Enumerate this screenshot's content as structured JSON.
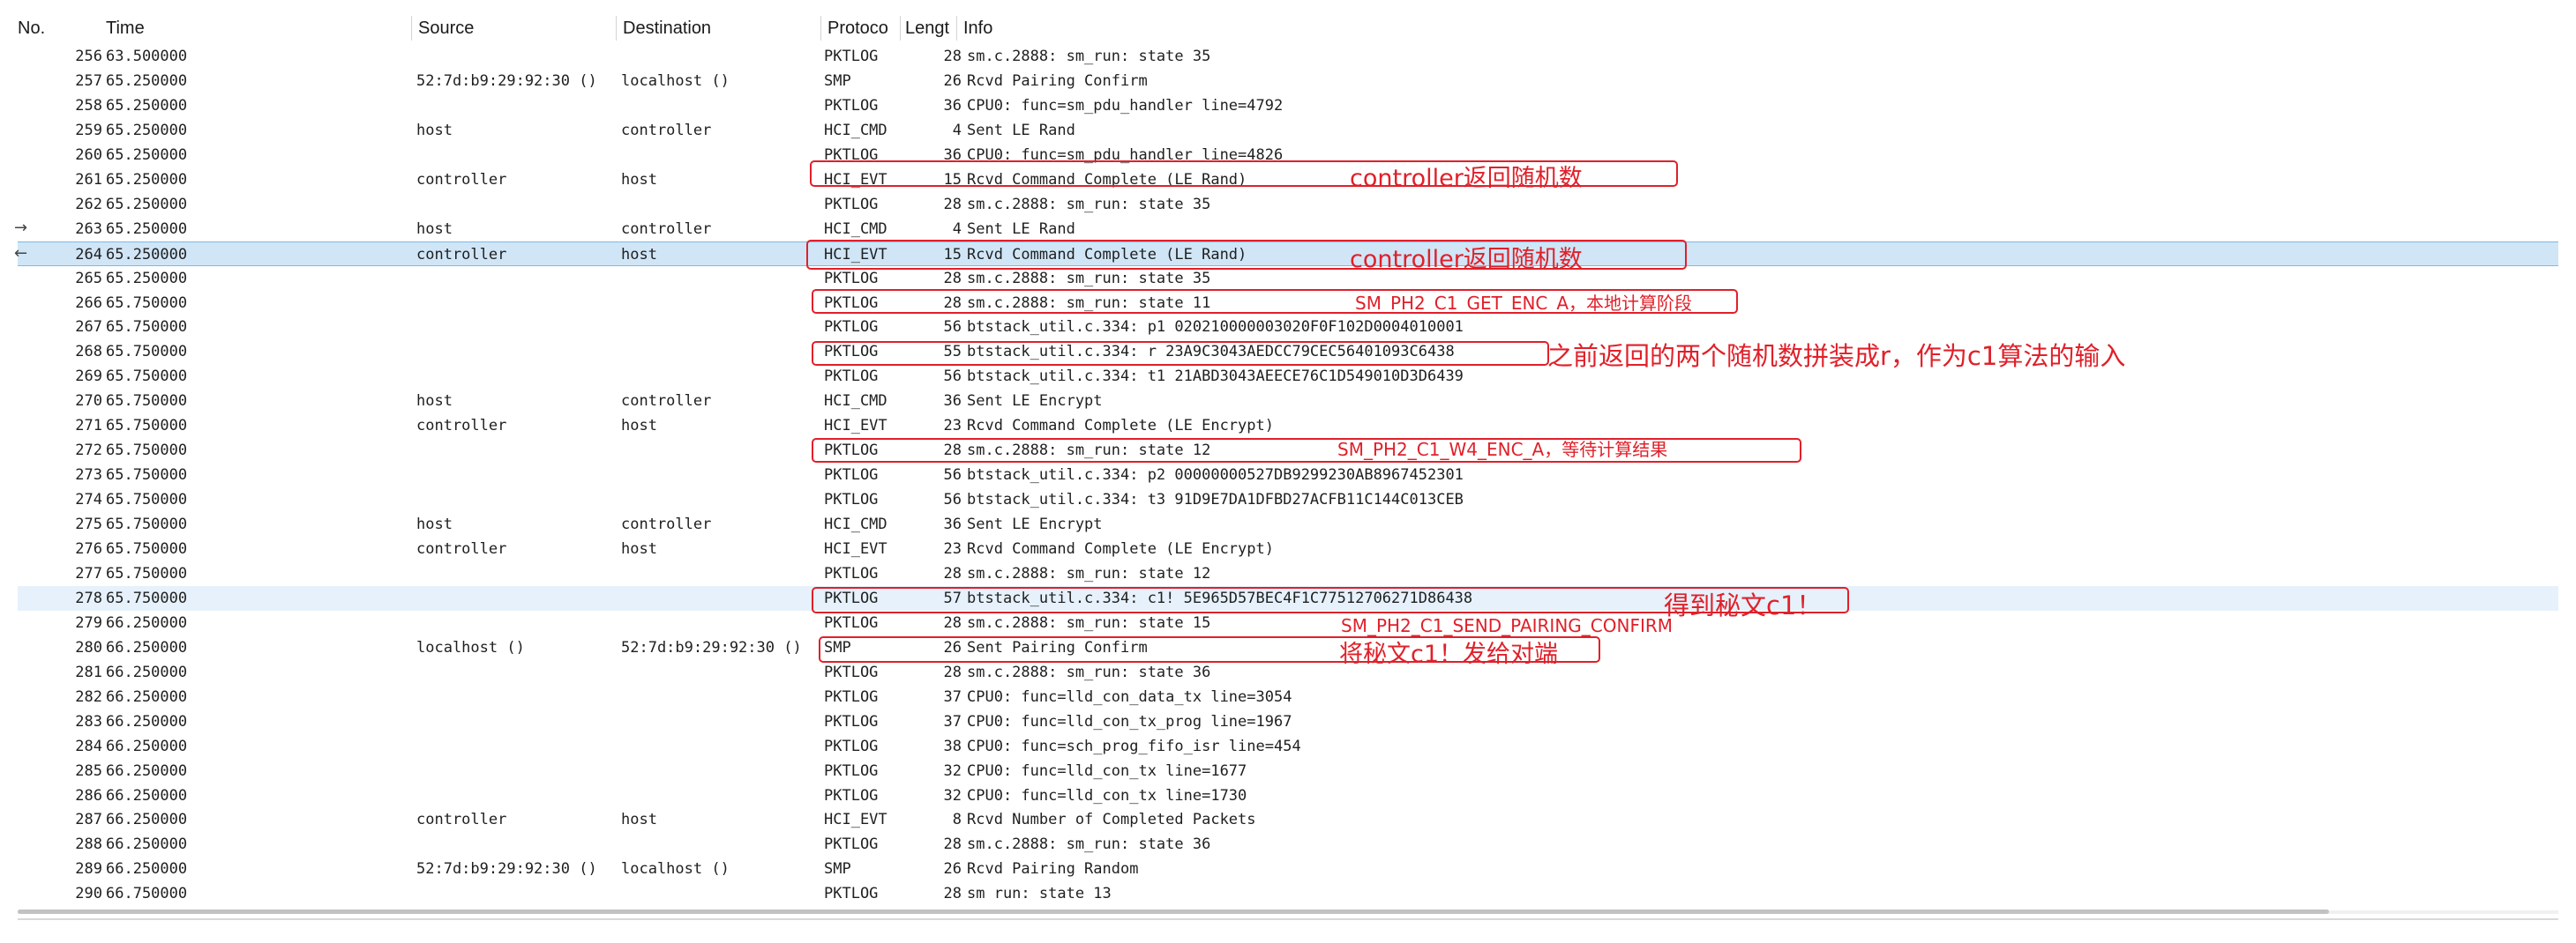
{
  "columns": {
    "no": "No.",
    "time": "Time",
    "source": "Source",
    "destination": "Destination",
    "protocol": "Protoco",
    "length": "Lengt",
    "info": "Info"
  },
  "rows": [
    {
      "no": "256",
      "time": "63.500000",
      "source": "",
      "destination": "",
      "protocol": "PKTLOG",
      "length": "28",
      "info": "sm.c.2888: sm_run: state 35"
    },
    {
      "no": "257",
      "time": "65.250000",
      "source": "52:7d:b9:29:92:30 ()",
      "destination": "localhost ()",
      "protocol": "SMP",
      "length": "26",
      "info": "Rcvd Pairing Confirm"
    },
    {
      "no": "258",
      "time": "65.250000",
      "source": "",
      "destination": "",
      "protocol": "PKTLOG",
      "length": "36",
      "info": "CPU0: func=sm_pdu_handler line=4792"
    },
    {
      "no": "259",
      "time": "65.250000",
      "source": "host",
      "destination": "controller",
      "protocol": "HCI_CMD",
      "length": "4",
      "info": "Sent LE Rand"
    },
    {
      "no": "260",
      "time": "65.250000",
      "source": "",
      "destination": "",
      "protocol": "PKTLOG",
      "length": "36",
      "info": "CPU0: func=sm_pdu_handler line=4826"
    },
    {
      "no": "261",
      "time": "65.250000",
      "source": "controller",
      "destination": "host",
      "protocol": "HCI_EVT",
      "length": "15",
      "info": "Rcvd Command Complete (LE Rand)"
    },
    {
      "no": "262",
      "time": "65.250000",
      "source": "",
      "destination": "",
      "protocol": "PKTLOG",
      "length": "28",
      "info": "sm.c.2888: sm_run: state 35"
    },
    {
      "no": "263",
      "time": "65.250000",
      "source": "host",
      "destination": "controller",
      "protocol": "HCI_CMD",
      "length": "4",
      "info": "Sent LE Rand"
    },
    {
      "no": "264",
      "time": "65.250000",
      "source": "controller",
      "destination": "host",
      "protocol": "HCI_EVT",
      "length": "15",
      "info": "Rcvd Command Complete (LE Rand)"
    },
    {
      "no": "265",
      "time": "65.250000",
      "source": "",
      "destination": "",
      "protocol": "PKTLOG",
      "length": "28",
      "info": "sm.c.2888: sm_run: state 35"
    },
    {
      "no": "266",
      "time": "65.750000",
      "source": "",
      "destination": "",
      "protocol": "PKTLOG",
      "length": "28",
      "info": "sm.c.2888: sm_run: state 11"
    },
    {
      "no": "267",
      "time": "65.750000",
      "source": "",
      "destination": "",
      "protocol": "PKTLOG",
      "length": "56",
      "info": "btstack_util.c.334: p1 020210000003020F0F102D0004010001"
    },
    {
      "no": "268",
      "time": "65.750000",
      "source": "",
      "destination": "",
      "protocol": "PKTLOG",
      "length": "55",
      "info": "btstack_util.c.334: r 23A9C3043AEDCC79CEC56401093C6438"
    },
    {
      "no": "269",
      "time": "65.750000",
      "source": "",
      "destination": "",
      "protocol": "PKTLOG",
      "length": "56",
      "info": "btstack_util.c.334: t1 21ABD3043AEECE76C1D549010D3D6439"
    },
    {
      "no": "270",
      "time": "65.750000",
      "source": "host",
      "destination": "controller",
      "protocol": "HCI_CMD",
      "length": "36",
      "info": "Sent LE Encrypt"
    },
    {
      "no": "271",
      "time": "65.750000",
      "source": "controller",
      "destination": "host",
      "protocol": "HCI_EVT",
      "length": "23",
      "info": "Rcvd Command Complete (LE Encrypt)"
    },
    {
      "no": "272",
      "time": "65.750000",
      "source": "",
      "destination": "",
      "protocol": "PKTLOG",
      "length": "28",
      "info": "sm.c.2888: sm_run: state 12"
    },
    {
      "no": "273",
      "time": "65.750000",
      "source": "",
      "destination": "",
      "protocol": "PKTLOG",
      "length": "56",
      "info": "btstack_util.c.334: p2 00000000527DB9299230AB8967452301"
    },
    {
      "no": "274",
      "time": "65.750000",
      "source": "",
      "destination": "",
      "protocol": "PKTLOG",
      "length": "56",
      "info": "btstack_util.c.334: t3 91D9E7DA1DFBD27ACFB11C144C013CEB"
    },
    {
      "no": "275",
      "time": "65.750000",
      "source": "host",
      "destination": "controller",
      "protocol": "HCI_CMD",
      "length": "36",
      "info": "Sent LE Encrypt"
    },
    {
      "no": "276",
      "time": "65.750000",
      "source": "controller",
      "destination": "host",
      "protocol": "HCI_EVT",
      "length": "23",
      "info": "Rcvd Command Complete (LE Encrypt)"
    },
    {
      "no": "277",
      "time": "65.750000",
      "source": "",
      "destination": "",
      "protocol": "PKTLOG",
      "length": "28",
      "info": "sm.c.2888: sm_run: state 12"
    },
    {
      "no": "278",
      "time": "65.750000",
      "source": "",
      "destination": "",
      "protocol": "PKTLOG",
      "length": "57",
      "info": "btstack_util.c.334: c1! 5E965D57BEC4F1C77512706271D86438"
    },
    {
      "no": "279",
      "time": "66.250000",
      "source": "",
      "destination": "",
      "protocol": "PKTLOG",
      "length": "28",
      "info": "sm.c.2888: sm_run: state 15"
    },
    {
      "no": "280",
      "time": "66.250000",
      "source": "localhost ()",
      "destination": "52:7d:b9:29:92:30 ()",
      "protocol": "SMP",
      "length": "26",
      "info": "Sent Pairing Confirm"
    },
    {
      "no": "281",
      "time": "66.250000",
      "source": "",
      "destination": "",
      "protocol": "PKTLOG",
      "length": "28",
      "info": "sm.c.2888: sm_run: state 36"
    },
    {
      "no": "282",
      "time": "66.250000",
      "source": "",
      "destination": "",
      "protocol": "PKTLOG",
      "length": "37",
      "info": "CPU0: func=lld_con_data_tx line=3054"
    },
    {
      "no": "283",
      "time": "66.250000",
      "source": "",
      "destination": "",
      "protocol": "PKTLOG",
      "length": "37",
      "info": "CPU0: func=lld_con_tx_prog line=1967"
    },
    {
      "no": "284",
      "time": "66.250000",
      "source": "",
      "destination": "",
      "protocol": "PKTLOG",
      "length": "38",
      "info": "CPU0: func=sch_prog_fifo_isr line=454"
    },
    {
      "no": "285",
      "time": "66.250000",
      "source": "",
      "destination": "",
      "protocol": "PKTLOG",
      "length": "32",
      "info": "CPU0: func=lld_con_tx line=1677"
    },
    {
      "no": "286",
      "time": "66.250000",
      "source": "",
      "destination": "",
      "protocol": "PKTLOG",
      "length": "32",
      "info": "CPU0: func=lld_con_tx line=1730"
    },
    {
      "no": "287",
      "time": "66.250000",
      "source": "controller",
      "destination": "host",
      "protocol": "HCI_EVT",
      "length": "8",
      "info": "Rcvd Number of Completed Packets"
    },
    {
      "no": "288",
      "time": "66.250000",
      "source": "",
      "destination": "",
      "protocol": "PKTLOG",
      "length": "28",
      "info": "sm.c.2888: sm_run: state 36"
    },
    {
      "no": "289",
      "time": "66.250000",
      "source": "52:7d:b9:29:92:30 ()",
      "destination": "localhost ()",
      "protocol": "SMP",
      "length": "26",
      "info": "Rcvd Pairing Random"
    },
    {
      "no": "290",
      "time": "66.750000",
      "source": "",
      "destination": "",
      "protocol": "PKTLOG",
      "length": "28",
      "info": "sm run: state 13"
    }
  ],
  "row_markers": {
    "request_arrow": "→",
    "response_arrow": "←"
  },
  "annotations": {
    "a261": "controller返回随机数",
    "a264": "controller返回随机数",
    "a266": "SM_PH2_C1_GET_ENC_A，本地计算阶段",
    "a268": "之前返回的两个随机数拼装成r，作为c1算法的输入",
    "a272": "SM_PH2_C1_W4_ENC_A，等待计算结果",
    "a278": "得到秘文c1！",
    "a280_top": "SM_PH2_C1_SEND_PAIRING_CONFIRM",
    "a280_bottom": "将秘文c1！发给对端"
  },
  "colors": {
    "annotation": "#e0202a",
    "selected_row": "#d0e6f7",
    "highlight_row": "#e6f1fb"
  }
}
